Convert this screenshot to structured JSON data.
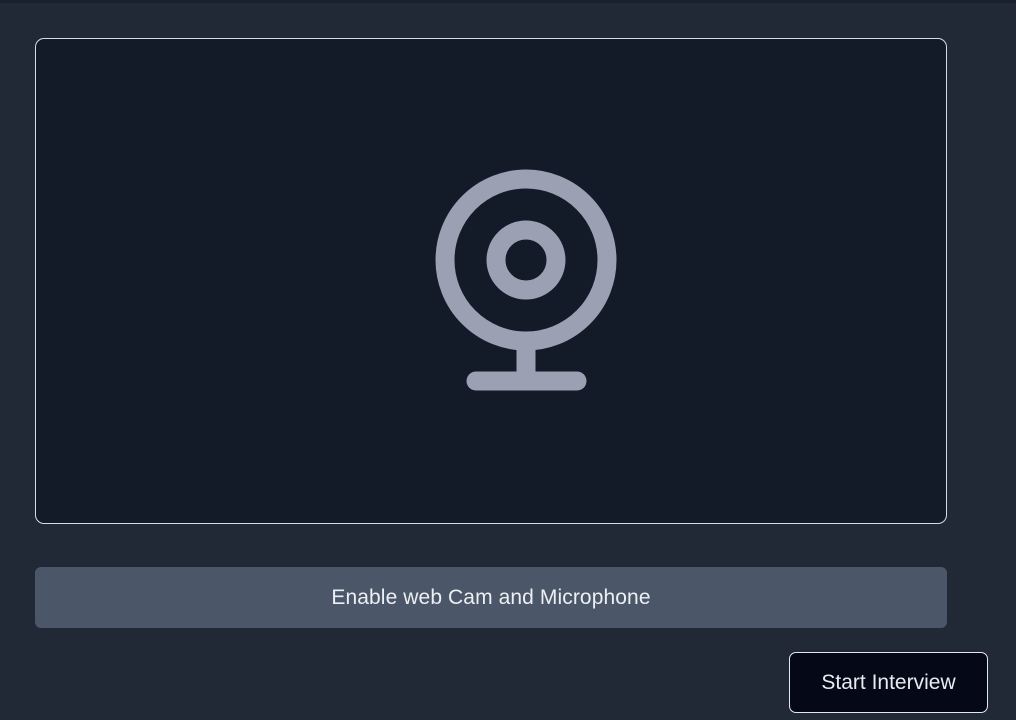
{
  "camera_preview": {
    "icon": "webcam-icon",
    "icon_color": "#9ca0b3"
  },
  "actions": {
    "enable_label": "Enable web Cam and Microphone",
    "start_label": "Start Interview"
  }
}
